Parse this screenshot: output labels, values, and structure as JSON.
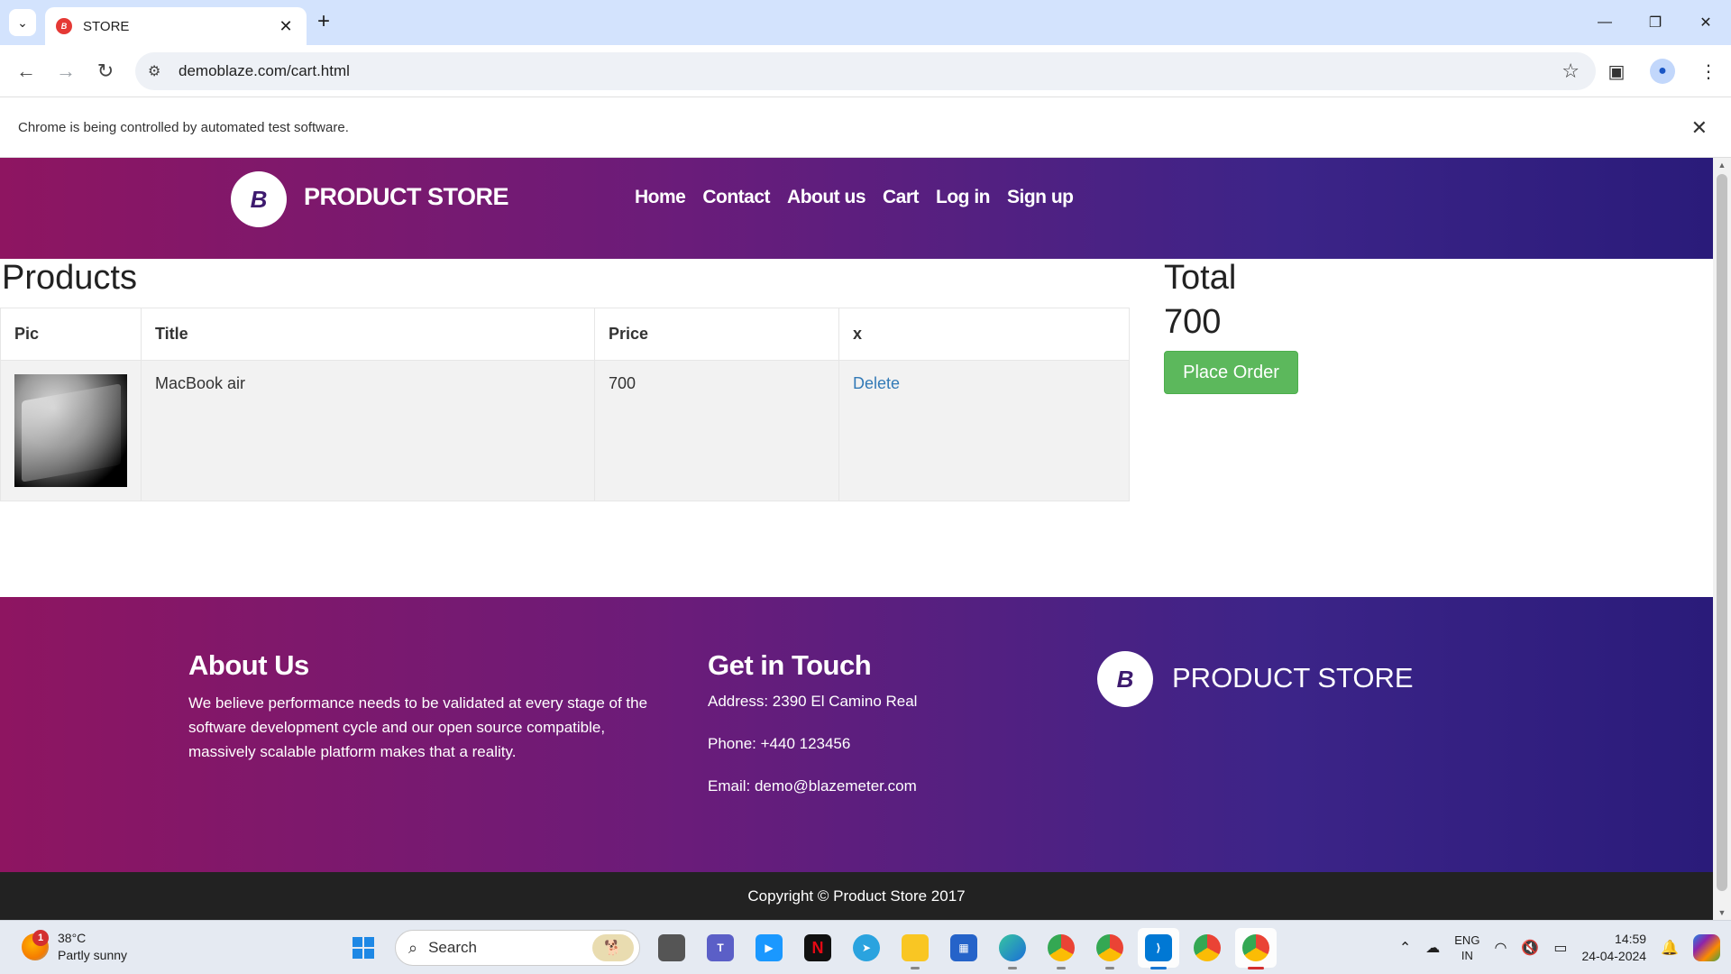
{
  "browser": {
    "tab_title": "STORE",
    "tab_favicon_text": "B",
    "new_tab_symbol": "+",
    "url": "demoblaze.com/cart.html",
    "infobar_text": "Chrome is being controlled by automated test software."
  },
  "site": {
    "brand": "PRODUCT STORE",
    "logo_letter": "B",
    "nav": [
      "Home",
      "Contact",
      "About us",
      "Cart",
      "Log in",
      "Sign up"
    ]
  },
  "cart": {
    "products_heading": "Products",
    "columns": [
      "Pic",
      "Title",
      "Price",
      "x"
    ],
    "rows": [
      {
        "title": "MacBook air",
        "price": "700",
        "action": "Delete"
      }
    ],
    "total_heading": "Total",
    "total_value": "700",
    "place_order_label": "Place Order"
  },
  "footer": {
    "about_heading": "About Us",
    "about_text": "We believe performance needs to be validated at every stage of the software development cycle and our open source compatible, massively scalable platform makes that a reality.",
    "touch_heading": "Get in Touch",
    "address": "Address: 2390 El Camino Real",
    "phone": "Phone: +440 123456",
    "email": "Email: demo@blazemeter.com",
    "brand": "PRODUCT STORE",
    "copyright": "Copyright © Product Store 2017"
  },
  "taskbar": {
    "weather_badge": "1",
    "temperature": "38°C",
    "weather_desc": "Partly sunny",
    "search_placeholder": "Search",
    "lang_line1": "ENG",
    "lang_line2": "IN",
    "time": "14:59",
    "date": "24-04-2024"
  },
  "colors": {
    "brand_gradient_start": "#8e1561",
    "brand_gradient_end": "#2a1b7a",
    "place_order_green": "#5cb85c",
    "link_blue": "#337ab7"
  }
}
